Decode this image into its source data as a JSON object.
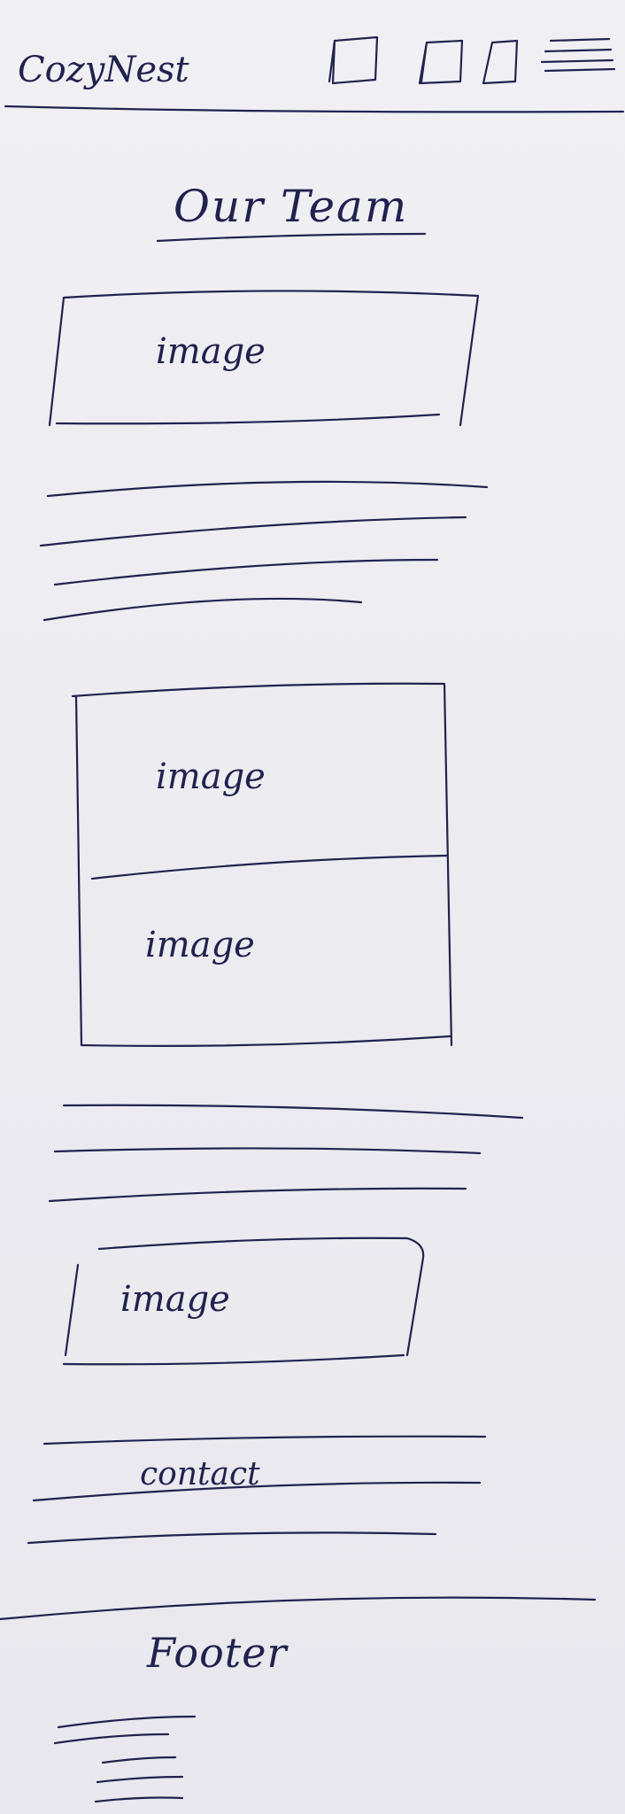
{
  "header": {
    "brand": "CozyNest"
  },
  "main": {
    "title": "Our Team",
    "section1": {
      "image_label": "image"
    },
    "section2": {
      "image_top_label": "image",
      "image_bottom_label": "image"
    },
    "section3": {
      "image_label": "image",
      "contact_label": "contact"
    }
  },
  "footer": {
    "label": "Footer"
  },
  "colors": {
    "ink": "#22224f",
    "paper": "#eeeef2"
  }
}
